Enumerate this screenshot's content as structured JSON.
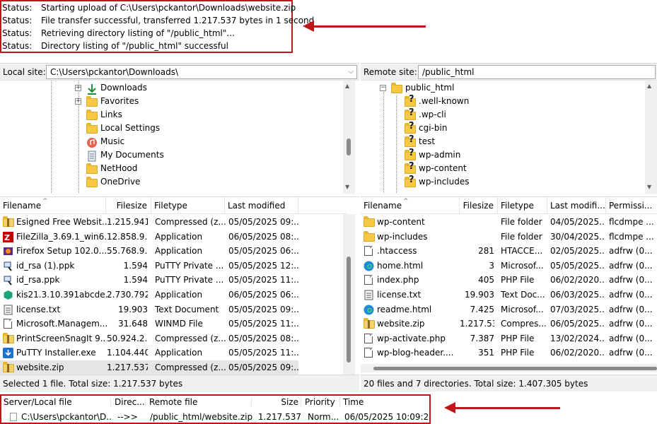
{
  "status_log": [
    {
      "label": "Status:",
      "message": "Starting upload of C:\\Users\\pckantor\\Downloads\\website.zip"
    },
    {
      "label": "Status:",
      "message": "File transfer successful, transferred 1.217.537 bytes in 1 second"
    },
    {
      "label": "Status:",
      "message": "Retrieving directory listing of \"/public_html\"..."
    },
    {
      "label": "Status:",
      "message": "Directory listing of \"/public_html\" successful"
    }
  ],
  "local_site": {
    "label": "Local site:",
    "path": "C:\\Users\\pckantor\\Downloads\\",
    "tree": [
      {
        "name": "Downloads",
        "icon": "download-arrow-icon",
        "expander": "+"
      },
      {
        "name": "Favorites",
        "icon": "folder-icon",
        "expander": "+"
      },
      {
        "name": "Links",
        "icon": "folder-icon",
        "expander": ""
      },
      {
        "name": "Local Settings",
        "icon": "folder-icon",
        "expander": ""
      },
      {
        "name": "Music",
        "icon": "music-icon",
        "expander": ""
      },
      {
        "name": "My Documents",
        "icon": "documents-icon",
        "expander": ""
      },
      {
        "name": "NetHood",
        "icon": "folder-icon",
        "expander": ""
      },
      {
        "name": "OneDrive",
        "icon": "folder-icon",
        "expander": ""
      }
    ],
    "columns": [
      "Filename",
      "Filesize",
      "Filetype",
      "Last modified"
    ],
    "files": [
      {
        "name": "Esigned Free Websit...",
        "size": "1.215.941",
        "type": "Compressed (z...",
        "modified": "05/05/2025 09:...",
        "icon": "zip-folder-icon"
      },
      {
        "name": "FileZilla_3.69.1_win6...",
        "size": "12.858.9...",
        "type": "Application",
        "modified": "06/05/2025 08:...",
        "icon": "filezilla-icon"
      },
      {
        "name": "Firefox Setup 102.0....",
        "size": "55.768.9...",
        "type": "Application",
        "modified": "05/05/2025 06:...",
        "icon": "installer-icon"
      },
      {
        "name": "id_rsa (1).ppk",
        "size": "1.594",
        "type": "PuTTY Private ...",
        "modified": "05/05/2025 12:...",
        "icon": "key-icon"
      },
      {
        "name": "id_rsa.ppk",
        "size": "1.594",
        "type": "PuTTY Private ...",
        "modified": "05/05/2025 11:...",
        "icon": "key-icon"
      },
      {
        "name": "kis21.3.10.391abcde...",
        "size": "2.730.792",
        "type": "Application",
        "modified": "06/05/2025 06:...",
        "icon": "shield-app-icon"
      },
      {
        "name": "license.txt",
        "size": "19.903",
        "type": "Text Document",
        "modified": "05/05/2025 09:...",
        "icon": "text-file-icon"
      },
      {
        "name": "Microsoft.Managem...",
        "size": "31.648",
        "type": "WINMD File",
        "modified": "05/05/2025 11:...",
        "icon": "file-icon"
      },
      {
        "name": "PrintScreenSnagIt 9....",
        "size": "50.924.2...",
        "type": "Compressed (z...",
        "modified": "05/05/2025 08:...",
        "icon": "zip-folder-icon"
      },
      {
        "name": "PuTTY Installer.exe",
        "size": "1.104.440",
        "type": "Application",
        "modified": "05/05/2025 11:...",
        "icon": "download-installer-icon"
      },
      {
        "name": "website.zip",
        "size": "1.217.537",
        "type": "Compressed (z...",
        "modified": "05/05/2025 09:...",
        "icon": "zip-folder-icon",
        "selected": true
      }
    ],
    "summary": "Selected 1 file. Total size: 1.217.537 bytes"
  },
  "remote_site": {
    "label": "Remote site:",
    "path": "/public_html",
    "tree": [
      {
        "name": "public_html",
        "icon": "folder-icon",
        "expander": "−"
      },
      {
        "name": ".well-known",
        "icon": "unknown-folder-icon"
      },
      {
        "name": ".wp-cli",
        "icon": "unknown-folder-icon"
      },
      {
        "name": "cgi-bin",
        "icon": "unknown-folder-icon"
      },
      {
        "name": "test",
        "icon": "unknown-folder-icon"
      },
      {
        "name": "wp-admin",
        "icon": "unknown-folder-icon"
      },
      {
        "name": "wp-content",
        "icon": "unknown-folder-icon"
      },
      {
        "name": "wp-includes",
        "icon": "unknown-folder-icon"
      }
    ],
    "columns": [
      "Filename",
      "Filesize",
      "Filetype",
      "Last modifi...",
      "Permissi..."
    ],
    "files": [
      {
        "name": "wp-content",
        "size": "",
        "type": "File folder",
        "modified": "04/05/2025...",
        "perms": "flcdmpe ...",
        "icon": "folder-icon"
      },
      {
        "name": "wp-includes",
        "size": "",
        "type": "File folder",
        "modified": "30/04/2025...",
        "perms": "flcdmpe ...",
        "icon": "folder-icon"
      },
      {
        "name": ".htaccess",
        "size": "281",
        "type": "HTACCE...",
        "modified": "02/05/2025...",
        "perms": "adfrw (0...",
        "icon": "file-icon"
      },
      {
        "name": "home.html",
        "size": "3",
        "type": "Microsof...",
        "modified": "05/05/2025...",
        "perms": "adfrw (0...",
        "icon": "edge-icon"
      },
      {
        "name": "index.php",
        "size": "405",
        "type": "PHP File",
        "modified": "06/02/2020...",
        "perms": "adfrw (0...",
        "icon": "file-icon"
      },
      {
        "name": "license.txt",
        "size": "19.903",
        "type": "Text Doc...",
        "modified": "06/03/2025...",
        "perms": "adfrw (0...",
        "icon": "text-file-icon"
      },
      {
        "name": "readme.html",
        "size": "7.425",
        "type": "Microsof...",
        "modified": "07/03/2025...",
        "perms": "adfrw (0...",
        "icon": "edge-icon"
      },
      {
        "name": "website.zip",
        "size": "1.217.537",
        "type": "Compres...",
        "modified": "06/05/2025...",
        "perms": "adfrw (0...",
        "icon": "zip-folder-icon"
      },
      {
        "name": "wp-activate.php",
        "size": "7.387",
        "type": "PHP File",
        "modified": "13/02/2024...",
        "perms": "adfrw (0...",
        "icon": "file-icon"
      },
      {
        "name": "wp-blog-header....",
        "size": "351",
        "type": "PHP File",
        "modified": "06/02/2020...",
        "perms": "adfrw (0...",
        "icon": "file-icon"
      }
    ],
    "summary": "20 files and 7 directories. Total size: 1.407.305 bytes"
  },
  "queue": {
    "columns": [
      "Server/Local file",
      "Direc...",
      "Remote file",
      "Size",
      "Priority",
      "Time"
    ],
    "rows": [
      {
        "local": "C:\\Users\\pckantor\\D...",
        "direction": "-->>",
        "remote": "/public_html/website.zip",
        "size": "1.217.537",
        "priority": "Norm...",
        "time": "06/05/2025 10:09:23"
      }
    ]
  },
  "colors": {
    "highlight": "#c0161b",
    "folder": "#f6c844",
    "selection": "#e5e5e5"
  }
}
